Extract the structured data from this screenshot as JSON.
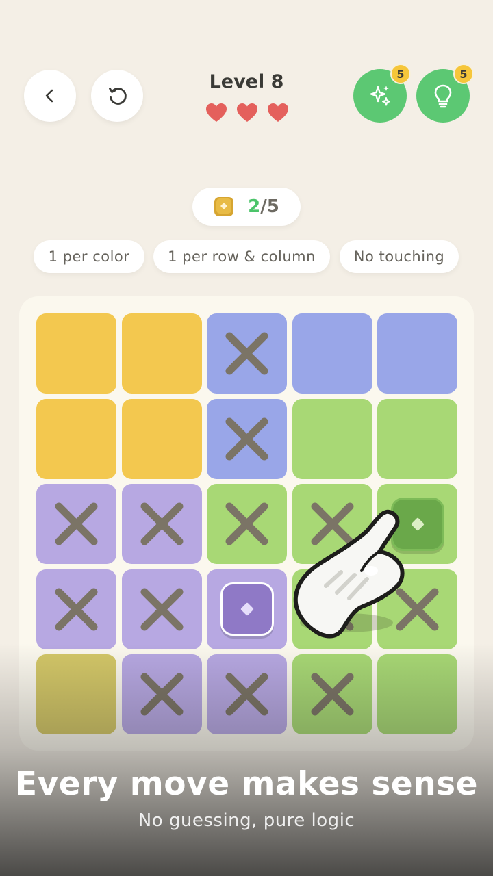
{
  "header": {
    "level_title": "Level 8",
    "lives": 3,
    "back_icon": "chevron-left-icon",
    "restart_icon": "restart-icon",
    "powerups": [
      {
        "name": "magic",
        "icon": "sparkles-icon",
        "count": "5"
      },
      {
        "name": "hint",
        "icon": "lightbulb-icon",
        "count": "5"
      }
    ]
  },
  "progress": {
    "current": "2",
    "total": "/5",
    "icon": "gold-gem-icon"
  },
  "rules": [
    "1 per color",
    "1 per row & column",
    "No touching"
  ],
  "board": {
    "size": 5,
    "colors": {
      "yellow": "#f3c84f",
      "blue": "#99a6e8",
      "green": "#a8d875",
      "purple": "#b7a8e2",
      "olive": "#d3c768",
      "x_mark": "#7b7466"
    },
    "cells": [
      [
        "yellow",
        "yellow",
        "blue",
        "blue",
        "blue"
      ],
      [
        "yellow",
        "yellow",
        "blue",
        "green",
        "green"
      ],
      [
        "purple",
        "purple",
        "green",
        "green",
        "green"
      ],
      [
        "purple",
        "purple",
        "purple",
        "green",
        "green"
      ],
      [
        "olive",
        "purple",
        "purple",
        "green",
        "green"
      ]
    ],
    "marks": [
      [
        "",
        "",
        "x",
        "",
        ""
      ],
      [
        "",
        "",
        "x",
        "",
        ""
      ],
      [
        "x",
        "x",
        "x",
        "x",
        "queen"
      ],
      [
        "x",
        "x",
        "queen",
        "x",
        "x"
      ],
      [
        "",
        "x",
        "x",
        "x",
        ""
      ]
    ]
  },
  "caption": {
    "headline": "Every move makes sense",
    "subtitle": "No guessing, pure logic"
  }
}
